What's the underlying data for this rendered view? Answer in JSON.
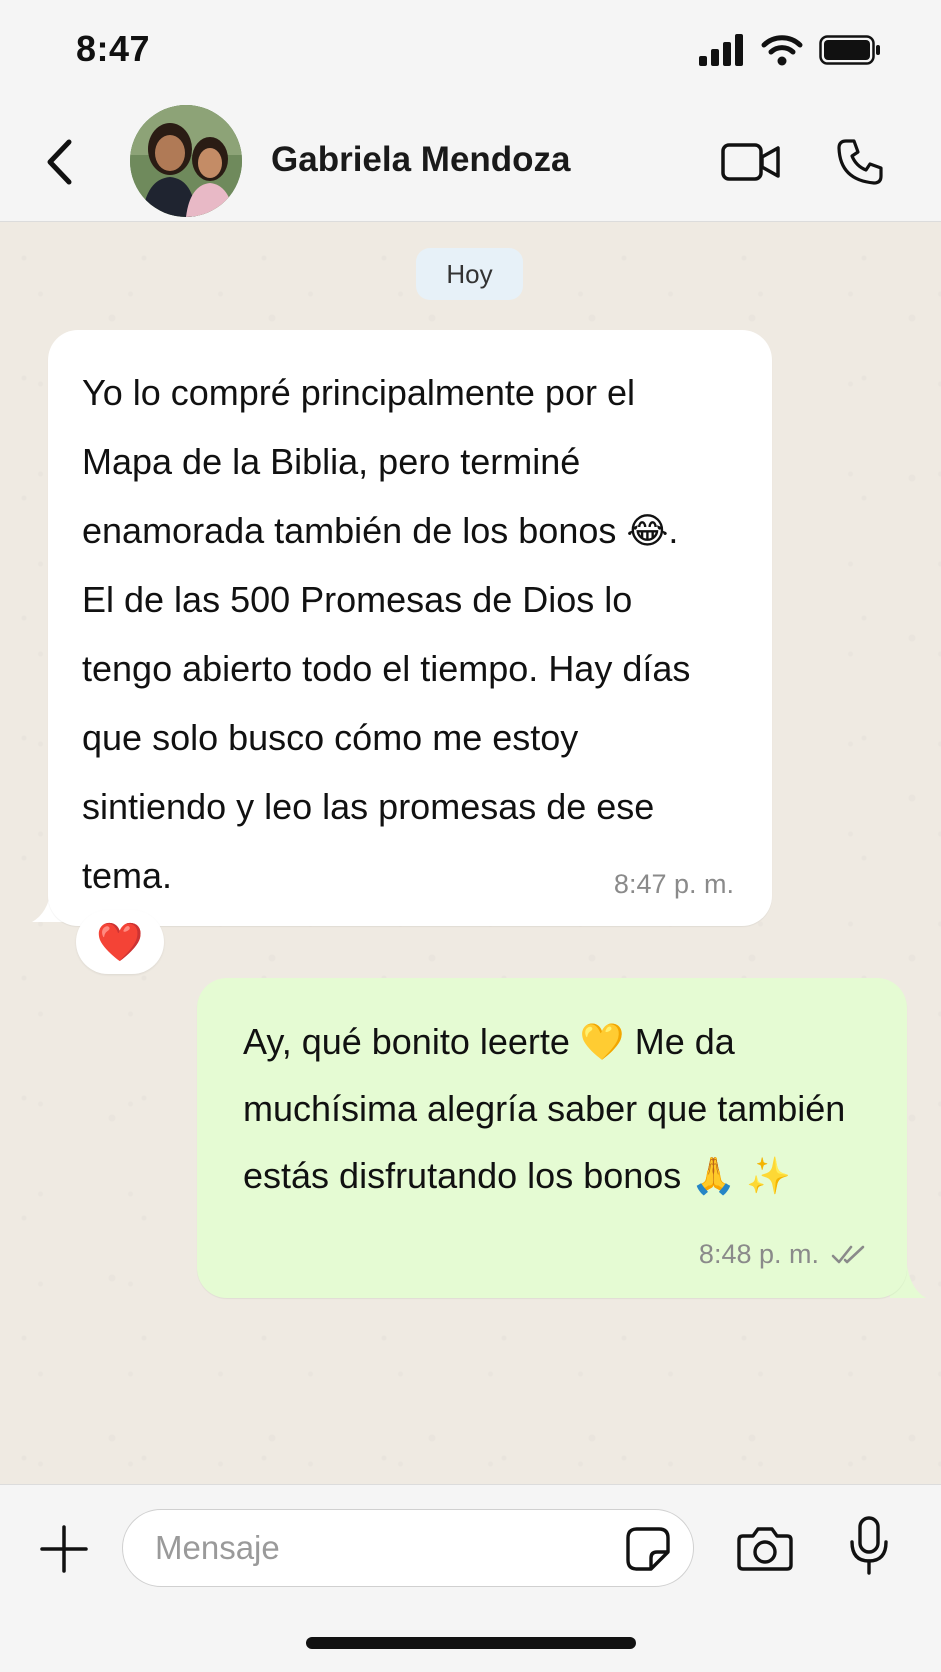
{
  "status_bar": {
    "time": "8:47"
  },
  "header": {
    "contact_name": "Gabriela Mendoza"
  },
  "chat": {
    "date_chip": "Hoy",
    "messages": [
      {
        "direction": "incoming",
        "text": "Yo lo compré principalmente por el\nMapa de la Biblia, pero terminé\nenamorada también de los bonos 😂.\nEl de las 500 Promesas de Dios lo\ntengo abierto todo el tiempo. Hay días\nque solo busco cómo me estoy\nsintiendo y leo las promesas de ese\ntema.",
        "time": "8:47 p. m.",
        "reaction": "❤️"
      },
      {
        "direction": "outgoing",
        "text": "Ay, qué bonito leerte 💛 Me da\nmuchísima alegría saber que también\nestás disfrutando los bonos 🙏 ✨",
        "time": "8:48 p. m.",
        "status": "read"
      }
    ]
  },
  "input": {
    "placeholder": "Mensaje"
  },
  "colors": {
    "incoming_bubble": "#ffffff",
    "outgoing_bubble": "#e5fbd3",
    "chat_background": "#efeae2",
    "date_chip": "#e7f1f8"
  }
}
